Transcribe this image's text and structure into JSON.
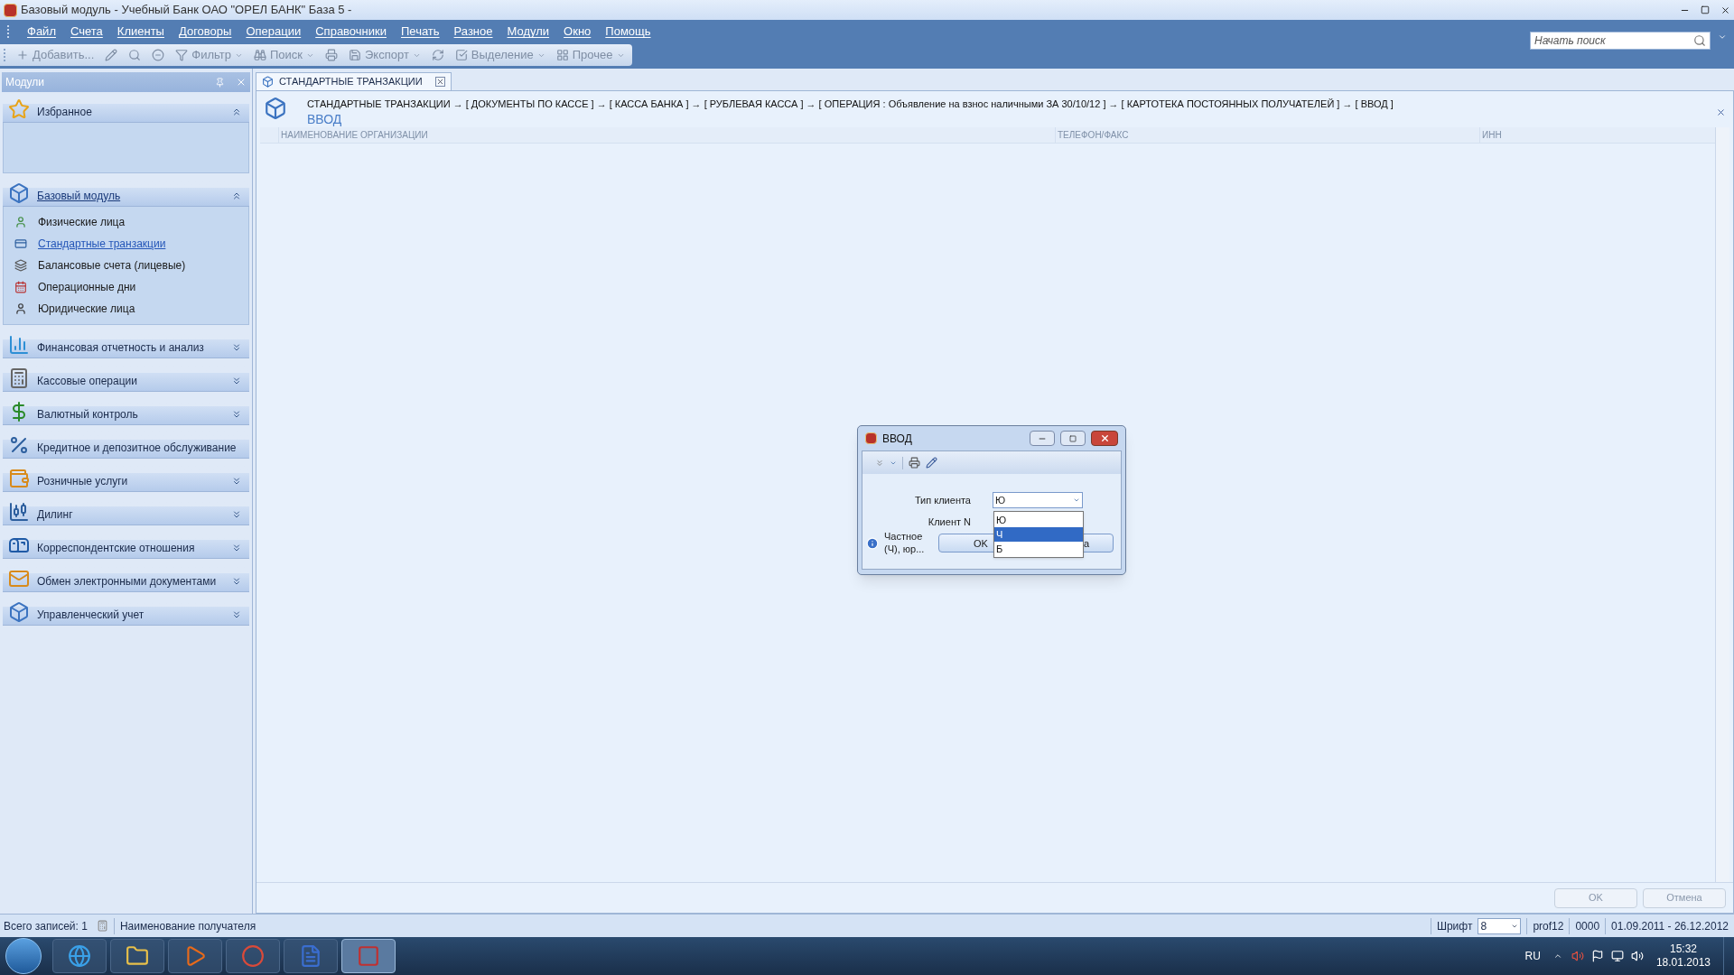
{
  "window": {
    "title": "Базовый модуль - Учебный Банк ОАО \"ОРЕЛ БАНК\" База 5 -"
  },
  "menu": [
    "Файл",
    "Счета",
    "Клиенты",
    "Договоры",
    "Операции",
    "Справочники",
    "Печать",
    "Разное",
    "Модули",
    "Окно",
    "Помощь"
  ],
  "toolbar": [
    {
      "kind": "labeled",
      "label": "Добавить...",
      "dropdown": false,
      "disabled": true
    },
    {
      "kind": "icon",
      "disabled": true
    },
    {
      "kind": "icon",
      "disabled": true
    },
    {
      "kind": "icon",
      "disabled": true
    },
    {
      "kind": "labeled",
      "label": "Фильтр",
      "dropdown": true,
      "disabled": true
    },
    {
      "kind": "labeled",
      "label": "Поиск",
      "dropdown": true,
      "disabled": true
    },
    {
      "kind": "icon",
      "disabled": true
    },
    {
      "kind": "labeled",
      "label": "Экспорт",
      "dropdown": true,
      "disabled": true
    },
    {
      "kind": "icon",
      "disabled": true
    },
    {
      "kind": "labeled",
      "label": "Выделение",
      "dropdown": true,
      "disabled": true
    },
    {
      "kind": "labeled",
      "label": "Прочее",
      "dropdown": true,
      "disabled": true
    }
  ],
  "search": {
    "placeholder": "Начать поиск"
  },
  "sidebar": {
    "title": "Модули",
    "groups": [
      {
        "label": "Избранное",
        "expanded": true,
        "selected": false
      },
      {
        "label": "Базовый модуль",
        "expanded": true,
        "selected": true,
        "items": [
          {
            "label": "Физические лица",
            "selected": false
          },
          {
            "label": "Стандартные транзакции",
            "selected": true
          },
          {
            "label": "Балансовые счета (лицевые)",
            "selected": false
          },
          {
            "label": "Операционные дни",
            "selected": false
          },
          {
            "label": "Юридические лица",
            "selected": false
          }
        ]
      },
      {
        "label": "Финансовая отчетность и анализ",
        "expanded": false,
        "selected": false
      },
      {
        "label": "Кассовые операции",
        "expanded": false,
        "selected": false
      },
      {
        "label": "Валютный контроль",
        "expanded": false,
        "selected": false
      },
      {
        "label": "Кредитное и депозитное обслуживание",
        "expanded": false,
        "selected": false
      },
      {
        "label": "Розничные услуги",
        "expanded": false,
        "selected": false
      },
      {
        "label": "Дилинг",
        "expanded": false,
        "selected": false
      },
      {
        "label": "Корреспондентские отношения",
        "expanded": false,
        "selected": false
      },
      {
        "label": "Обмен электронными документами",
        "expanded": false,
        "selected": false
      },
      {
        "label": "Управленческий учет",
        "expanded": false,
        "selected": false
      }
    ]
  },
  "tab": {
    "label": "СТАНДАРТНЫЕ ТРАНЗАКЦИИ"
  },
  "breadcrumb": "СТАНДАРТНЫЕ ТРАНЗАКЦИИ  → [ ДОКУМЕНТЫ ПО КАССЕ ] → [ КАССА БАНКА ] → [ РУБЛЕВАЯ КАССА ] → [ ОПЕРАЦИЯ : Объявление на взнос наличными ЗА 30/10/12 ] → [ КАРТОТЕКА ПОСТОЯННЫХ ПОЛУЧАТЕЛЕЙ ] → [ ВВОД ]",
  "heading": "ВВОД",
  "table": {
    "columns": [
      "НАИМЕНОВАНИЕ ОРГАНИЗАЦИИ",
      "ТЕЛЕФОН/ФАКС",
      "ИНН"
    ]
  },
  "footer_buttons": [
    {
      "label": "OK",
      "disabled": true
    },
    {
      "label": "Отмена",
      "disabled": true
    }
  ],
  "status_bar": {
    "records": "Всего записей: 1",
    "field": "Наименование получателя",
    "font_label": "Шрифт",
    "font_value": "8",
    "user": "prof12",
    "code": "0000",
    "period": "01.09.2011 - 26.12.2012"
  },
  "dialog": {
    "title": "ВВОД",
    "fields": [
      {
        "label": "Тип клиента",
        "value": "Ю"
      },
      {
        "label": "Клиент N"
      }
    ],
    "options": [
      {
        "label": "Ю",
        "selected": false
      },
      {
        "label": "Ч",
        "selected": true
      },
      {
        "label": "Б",
        "selected": false
      }
    ],
    "hint": "Частное (Ч), юр...",
    "buttons": [
      "OK",
      "а"
    ]
  },
  "taskbar": {
    "apps": [
      {
        "selected": false
      },
      {
        "selected": false
      },
      {
        "selected": false
      },
      {
        "selected": false
      },
      {
        "selected": false
      },
      {
        "selected": true
      }
    ],
    "language": "RU",
    "time": "15:32",
    "date": "18.01.2013"
  }
}
